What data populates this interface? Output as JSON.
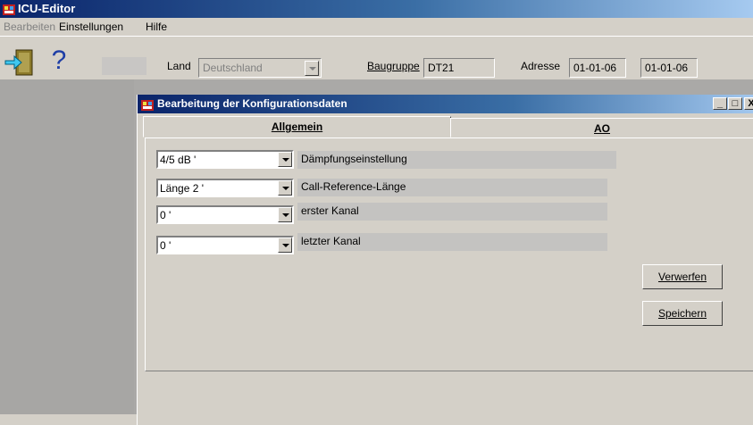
{
  "window": {
    "title": "ICU-Editor"
  },
  "menu": [
    {
      "label": "Bearbeiten",
      "enabled": false
    },
    {
      "label": "Einstellungen",
      "enabled": true
    },
    {
      "label": "Hilfe",
      "enabled": true
    }
  ],
  "toolbar": {
    "help_glyph": "?",
    "land_label": "Land",
    "land_value": "Deutschland",
    "baugruppe_label": "Baugruppe",
    "baugruppe_value": "DT21",
    "adresse_label": "Adresse",
    "adresse_value": "01-01-06",
    "adresse_value2": "01-01-06"
  },
  "dialog": {
    "title": "Bearbeitung der Konfigurationsdaten",
    "min_glyph": "_",
    "max_glyph": "□",
    "close_glyph": "X",
    "tabs": [
      {
        "label": "Allgemein",
        "active": true
      },
      {
        "label": "AO",
        "active": false
      }
    ],
    "rows": [
      {
        "value": "4/5 dB '",
        "label": "Dämpfungseinstellung"
      },
      {
        "value": "Länge 2 '",
        "label": "Call-Reference-Länge"
      },
      {
        "value": "0 '",
        "label": "erster Kanal"
      },
      {
        "value": "0 '",
        "label": "letzter Kanal"
      }
    ],
    "buttons": {
      "discard": "Verwerfen",
      "save": "Speichern"
    }
  },
  "colors": {
    "titlebar_start": "#0a246a",
    "titlebar_end": "#a6caf0",
    "face": "#d4d0c8",
    "workspace": "#a7a6a4"
  },
  "icons": [
    "exit-door-icon",
    "help-icon",
    "app-icon",
    "dialog-icon",
    "minimize-icon",
    "maximize-icon",
    "close-icon",
    "dropdown-arrow-icon"
  ]
}
